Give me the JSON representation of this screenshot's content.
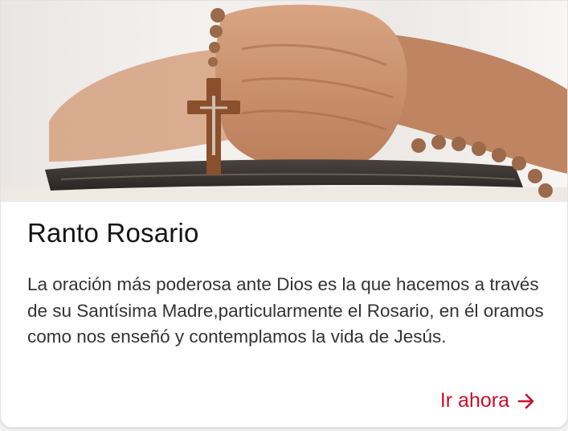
{
  "card": {
    "image_alt": "praying-hands-with-rosary",
    "title": "Ranto Rosario",
    "description": "La oración más poderosa ante Dios es la que hacemos a través de su Santísima Madre,particularmente el Rosario, en él oramos como nos enseñó y contemplamos la vida de Jesús.",
    "cta_label": "Ir ahora",
    "cta_icon": "arrow-right-icon"
  },
  "colors": {
    "accent": "#c8102e",
    "title": "#141414",
    "text": "#333333",
    "card_bg": "#ffffff"
  }
}
